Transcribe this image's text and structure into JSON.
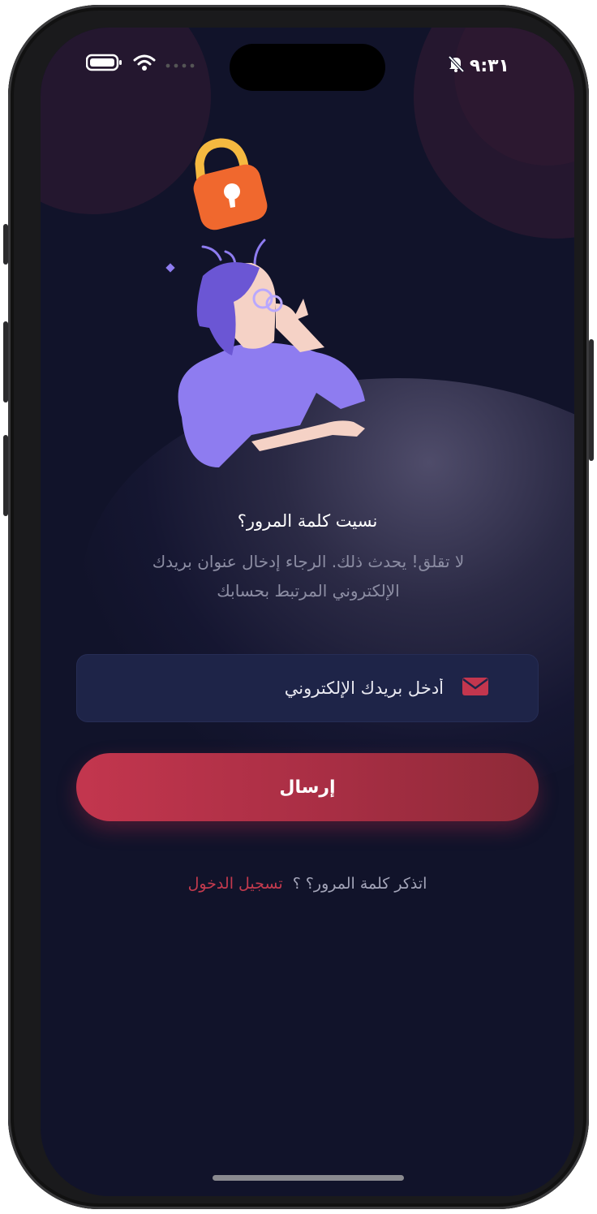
{
  "status_bar": {
    "time": "٩:٣١",
    "icons": [
      "battery-icon",
      "wifi-icon",
      "signal-dots-icon",
      "bell-muted-icon"
    ]
  },
  "illustration": {
    "icons": [
      "padlock-icon",
      "woman-thinking-illustration"
    ]
  },
  "forgot": {
    "title": "نسيت كلمة المرور؟",
    "subtitle": "لا تقلق! يحدث ذلك. الرجاء إدخال عنوان بريدك الإلكتروني المرتبط بحسابك"
  },
  "email": {
    "placeholder": "أدخل بريدك الإلكتروني",
    "value": "",
    "icon": "mail-icon"
  },
  "send_button": {
    "label": "إرسال"
  },
  "footer": {
    "prompt": "اتذكر كلمة المرور؟ ؟",
    "login_link": "تسجيل الدخول"
  },
  "colors": {
    "background": "#11132a",
    "accent": "#c3364e",
    "input_bg": "#1e2448",
    "figure_purple": "#8e7cf0",
    "lock_orange": "#f0682e"
  }
}
